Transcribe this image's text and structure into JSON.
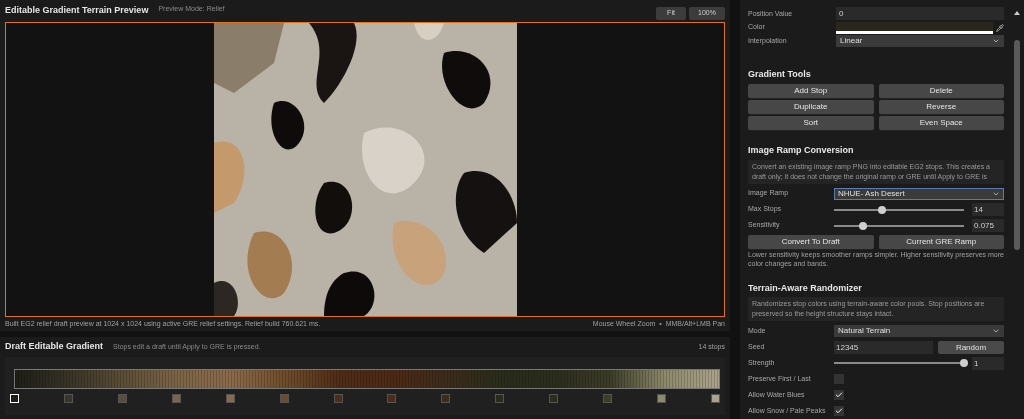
{
  "preview": {
    "title": "Editable Gradient Terrain Preview",
    "mode": "Preview Mode: Relief",
    "buttons": [
      "Fit",
      "100%"
    ],
    "status": "Built EG2 relief draft preview at 1024 x 1024 using active GRE relief settings. Relief build 760.621 ms.",
    "hint": "Mouse Wheel Zoom  •  MMB/Alt+LMB Pan"
  },
  "draft": {
    "title": "Draft Editable Gradient",
    "note": "Stops edit a draft until Apply to GRE is pressed.",
    "count": "14 stops",
    "stops": [
      {
        "color": "#1e1e18",
        "selected": true
      },
      {
        "color": "#383426",
        "selected": false
      },
      {
        "color": "#5a4e36",
        "selected": false
      },
      {
        "color": "#7c6446",
        "selected": false
      },
      {
        "color": "#8a6a4a",
        "selected": false
      },
      {
        "color": "#6e4c2a",
        "selected": false
      },
      {
        "color": "#4e2c16",
        "selected": false
      },
      {
        "color": "#4c2a16",
        "selected": false
      },
      {
        "color": "#3c2c1a",
        "selected": false
      },
      {
        "color": "#2a2c1a",
        "selected": false
      },
      {
        "color": "#2c2e1c",
        "selected": false
      },
      {
        "color": "#3c3c28",
        "selected": false
      },
      {
        "color": "#8c8a6a",
        "selected": false
      },
      {
        "color": "#aaa28a",
        "selected": false
      }
    ]
  },
  "stop_editor": {
    "position": {
      "label": "Position Value",
      "value": "0"
    },
    "color": {
      "label": "Color",
      "color": "#29261d"
    },
    "interpolation": {
      "label": "Interpolation",
      "value": "Linear"
    }
  },
  "sections": [
    {
      "title": "Gradient Tools",
      "buttons": [
        "Add Stop",
        "Delete",
        "Duplicate",
        "Reverse",
        "Sort",
        "Even Space"
      ]
    },
    {
      "title": "Image Ramp Conversion",
      "description": "Convert an existing image ramp PNG into editable EG2 stops. This creates a draft only; it does not change the original ramp or GRE until Apply to GRE is",
      "rows": [
        {
          "kind": "dropdown",
          "label": "Image Ramp",
          "value": "NHUE- Ash Desert",
          "focused": true
        },
        {
          "kind": "slider",
          "label": "Max Stops",
          "level": 0.37,
          "value": "14"
        },
        {
          "kind": "slider",
          "label": "Sensitivity",
          "level": 0.22,
          "value": "0.075"
        }
      ],
      "buttons": [
        "Convert To Draft",
        "Current GRE Ramp"
      ],
      "help": "Lower sensitivity keeps smoother ramps simpler. Higher sensitivity preserves more color changes and bands."
    },
    {
      "title": "Terrain-Aware Randomizer",
      "description": "Randomizes stop colors using terrain-aware color pools. Stop positions are preserved so the height structure stays intact.",
      "rows": [
        {
          "kind": "dropdown",
          "label": "Mode",
          "value": "Natural Terrain",
          "focused": false
        },
        {
          "kind": "seed",
          "label": "Seed",
          "value": "12345",
          "button": "Random"
        },
        {
          "kind": "slider",
          "label": "Strength",
          "level": 1,
          "value": "1"
        },
        {
          "kind": "checkbox",
          "label": "Preserve First / Last",
          "checked": false
        },
        {
          "kind": "checkbox",
          "label": "Allow Water Blues",
          "checked": true
        },
        {
          "kind": "checkbox",
          "label": "Allow Snow / Pale Peaks",
          "checked": true
        }
      ]
    }
  ]
}
